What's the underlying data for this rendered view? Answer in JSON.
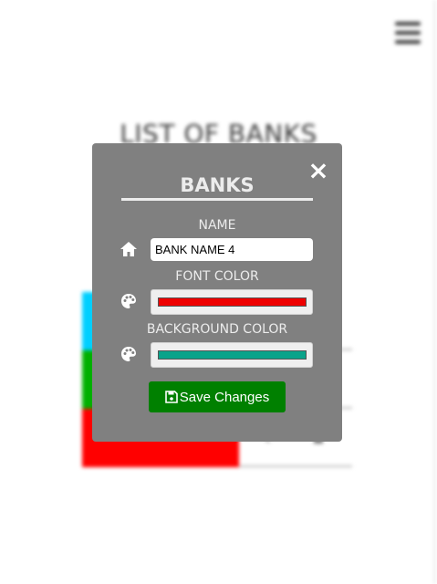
{
  "background": {
    "page_title": "LIST OF BANKS",
    "banks": [
      {
        "color": "#00cfff"
      },
      {
        "color": "#00b000"
      },
      {
        "color": "#ff0000"
      }
    ]
  },
  "modal": {
    "title": "BANKS",
    "close_label": "×",
    "name": {
      "label": "NAME",
      "value": "BANK NAME 4",
      "icon": "home-icon"
    },
    "font_color": {
      "label": "FONT COLOR",
      "value": "#ee0000",
      "icon": "palette-icon"
    },
    "background_color": {
      "label": "BACKGROUND COLOR",
      "value": "#0aa38a",
      "icon": "palette-icon"
    },
    "save_button": {
      "label": "Save Changes",
      "icon": "floppy-disk-icon",
      "color": "#008000"
    }
  }
}
